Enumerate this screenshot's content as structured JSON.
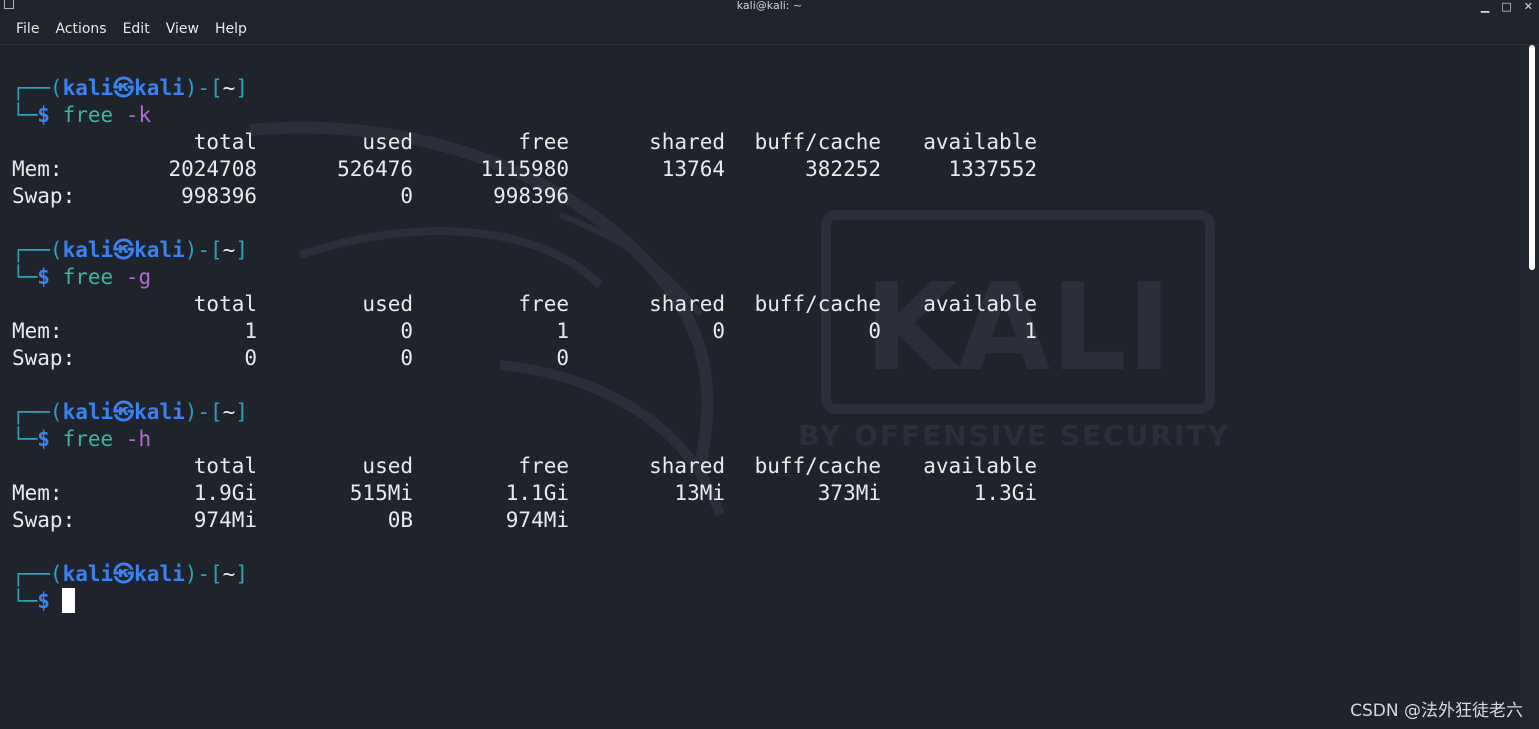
{
  "window": {
    "title": "kali@kali: ~"
  },
  "menu": [
    "File",
    "Actions",
    "Edit",
    "View",
    "Help"
  ],
  "prompt": {
    "user": "kali",
    "host": "kali",
    "dir": "~"
  },
  "headers": [
    "total",
    "used",
    "free",
    "shared",
    "buff/cache",
    "available"
  ],
  "blocks": [
    {
      "cmd": "free",
      "flag": "-k",
      "mem": [
        "2024708",
        "526476",
        "1115980",
        "13764",
        "382252",
        "1337552"
      ],
      "swap": [
        "998396",
        "0",
        "998396"
      ]
    },
    {
      "cmd": "free",
      "flag": "-g",
      "mem": [
        "1",
        "0",
        "1",
        "0",
        "0",
        "1"
      ],
      "swap": [
        "0",
        "0",
        "0"
      ]
    },
    {
      "cmd": "free",
      "flag": "-h",
      "mem": [
        "1.9Gi",
        "515Mi",
        "1.1Gi",
        "13Mi",
        "373Mi",
        "1.3Gi"
      ],
      "swap": [
        "974Mi",
        "0B",
        "974Mi"
      ]
    }
  ],
  "row_labels": {
    "mem": "Mem:",
    "swap": "Swap:"
  },
  "watermark": {
    "brand": "KALI",
    "tagline": "BY OFFENSIVE SECURITY"
  },
  "credit": "CSDN @法外狂徒老六"
}
